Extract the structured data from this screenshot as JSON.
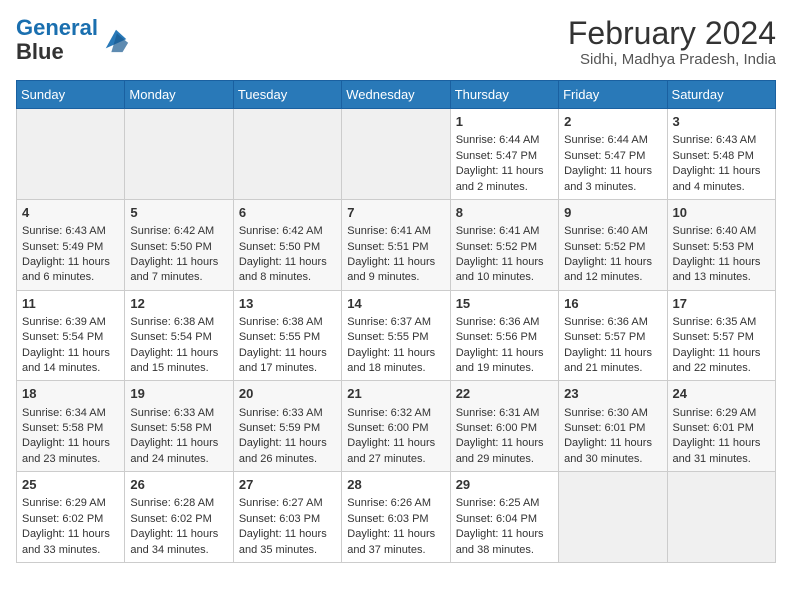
{
  "logo": {
    "line1": "General",
    "line2": "Blue"
  },
  "title": "February 2024",
  "subtitle": "Sidhi, Madhya Pradesh, India",
  "days_of_week": [
    "Sunday",
    "Monday",
    "Tuesday",
    "Wednesday",
    "Thursday",
    "Friday",
    "Saturday"
  ],
  "weeks": [
    [
      {
        "day": "",
        "info": ""
      },
      {
        "day": "",
        "info": ""
      },
      {
        "day": "",
        "info": ""
      },
      {
        "day": "",
        "info": ""
      },
      {
        "day": "1",
        "info": "Sunrise: 6:44 AM\nSunset: 5:47 PM\nDaylight: 11 hours and 2 minutes."
      },
      {
        "day": "2",
        "info": "Sunrise: 6:44 AM\nSunset: 5:47 PM\nDaylight: 11 hours and 3 minutes."
      },
      {
        "day": "3",
        "info": "Sunrise: 6:43 AM\nSunset: 5:48 PM\nDaylight: 11 hours and 4 minutes."
      }
    ],
    [
      {
        "day": "4",
        "info": "Sunrise: 6:43 AM\nSunset: 5:49 PM\nDaylight: 11 hours and 6 minutes."
      },
      {
        "day": "5",
        "info": "Sunrise: 6:42 AM\nSunset: 5:50 PM\nDaylight: 11 hours and 7 minutes."
      },
      {
        "day": "6",
        "info": "Sunrise: 6:42 AM\nSunset: 5:50 PM\nDaylight: 11 hours and 8 minutes."
      },
      {
        "day": "7",
        "info": "Sunrise: 6:41 AM\nSunset: 5:51 PM\nDaylight: 11 hours and 9 minutes."
      },
      {
        "day": "8",
        "info": "Sunrise: 6:41 AM\nSunset: 5:52 PM\nDaylight: 11 hours and 10 minutes."
      },
      {
        "day": "9",
        "info": "Sunrise: 6:40 AM\nSunset: 5:52 PM\nDaylight: 11 hours and 12 minutes."
      },
      {
        "day": "10",
        "info": "Sunrise: 6:40 AM\nSunset: 5:53 PM\nDaylight: 11 hours and 13 minutes."
      }
    ],
    [
      {
        "day": "11",
        "info": "Sunrise: 6:39 AM\nSunset: 5:54 PM\nDaylight: 11 hours and 14 minutes."
      },
      {
        "day": "12",
        "info": "Sunrise: 6:38 AM\nSunset: 5:54 PM\nDaylight: 11 hours and 15 minutes."
      },
      {
        "day": "13",
        "info": "Sunrise: 6:38 AM\nSunset: 5:55 PM\nDaylight: 11 hours and 17 minutes."
      },
      {
        "day": "14",
        "info": "Sunrise: 6:37 AM\nSunset: 5:55 PM\nDaylight: 11 hours and 18 minutes."
      },
      {
        "day": "15",
        "info": "Sunrise: 6:36 AM\nSunset: 5:56 PM\nDaylight: 11 hours and 19 minutes."
      },
      {
        "day": "16",
        "info": "Sunrise: 6:36 AM\nSunset: 5:57 PM\nDaylight: 11 hours and 21 minutes."
      },
      {
        "day": "17",
        "info": "Sunrise: 6:35 AM\nSunset: 5:57 PM\nDaylight: 11 hours and 22 minutes."
      }
    ],
    [
      {
        "day": "18",
        "info": "Sunrise: 6:34 AM\nSunset: 5:58 PM\nDaylight: 11 hours and 23 minutes."
      },
      {
        "day": "19",
        "info": "Sunrise: 6:33 AM\nSunset: 5:58 PM\nDaylight: 11 hours and 24 minutes."
      },
      {
        "day": "20",
        "info": "Sunrise: 6:33 AM\nSunset: 5:59 PM\nDaylight: 11 hours and 26 minutes."
      },
      {
        "day": "21",
        "info": "Sunrise: 6:32 AM\nSunset: 6:00 PM\nDaylight: 11 hours and 27 minutes."
      },
      {
        "day": "22",
        "info": "Sunrise: 6:31 AM\nSunset: 6:00 PM\nDaylight: 11 hours and 29 minutes."
      },
      {
        "day": "23",
        "info": "Sunrise: 6:30 AM\nSunset: 6:01 PM\nDaylight: 11 hours and 30 minutes."
      },
      {
        "day": "24",
        "info": "Sunrise: 6:29 AM\nSunset: 6:01 PM\nDaylight: 11 hours and 31 minutes."
      }
    ],
    [
      {
        "day": "25",
        "info": "Sunrise: 6:29 AM\nSunset: 6:02 PM\nDaylight: 11 hours and 33 minutes."
      },
      {
        "day": "26",
        "info": "Sunrise: 6:28 AM\nSunset: 6:02 PM\nDaylight: 11 hours and 34 minutes."
      },
      {
        "day": "27",
        "info": "Sunrise: 6:27 AM\nSunset: 6:03 PM\nDaylight: 11 hours and 35 minutes."
      },
      {
        "day": "28",
        "info": "Sunrise: 6:26 AM\nSunset: 6:03 PM\nDaylight: 11 hours and 37 minutes."
      },
      {
        "day": "29",
        "info": "Sunrise: 6:25 AM\nSunset: 6:04 PM\nDaylight: 11 hours and 38 minutes."
      },
      {
        "day": "",
        "info": ""
      },
      {
        "day": "",
        "info": ""
      }
    ]
  ]
}
